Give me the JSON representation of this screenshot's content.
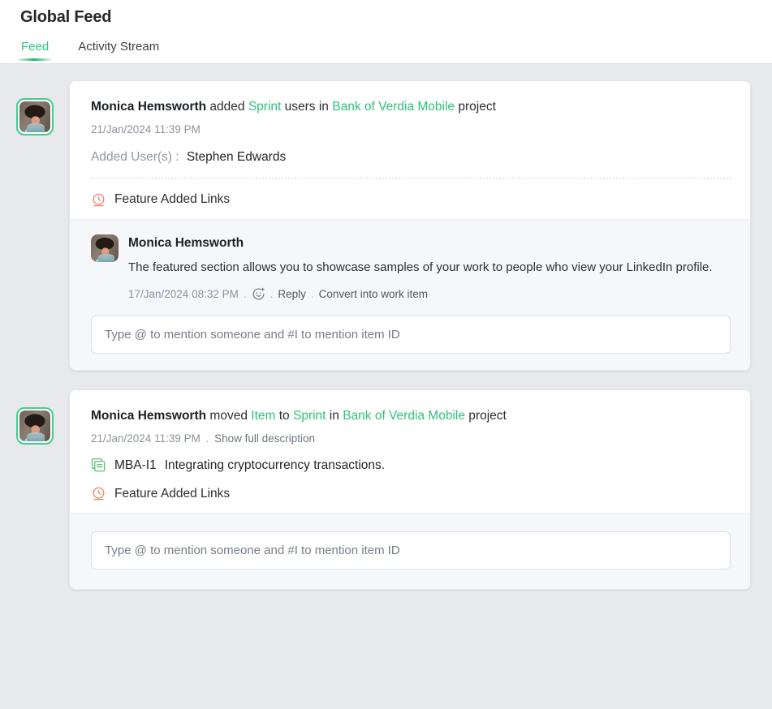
{
  "header": {
    "title": "Global Feed",
    "tabs": [
      {
        "label": "Feed",
        "active": true
      },
      {
        "label": "Activity Stream",
        "active": false
      }
    ]
  },
  "feed": {
    "items": [
      {
        "avatar_alt": "Monica Hemsworth",
        "activity": {
          "actor": "Monica Hemsworth",
          "verb": "added",
          "object": "Sprint",
          "middle": "users in",
          "project": "Bank of Verdia Mobile",
          "suffix": "project"
        },
        "timestamp": "21/Jan/2024 11:39 PM",
        "added_users": {
          "label": "Added User(s) :",
          "value": "Stephen Edwards"
        },
        "feature": {
          "icon": "clock-icon",
          "label": "Feature Added Links"
        },
        "comment": {
          "author": "Monica Hemsworth",
          "text": "The featured section allows you to showcase samples of your work to people who view your LinkedIn profile.",
          "timestamp": "17/Jan/2024 08:32 PM",
          "reaction_icon": "add-reaction-icon",
          "reply_label": "Reply",
          "convert_label": "Convert into work item",
          "separator": "."
        },
        "input_placeholder": "Type @ to mention someone and #I to mention item ID"
      },
      {
        "avatar_alt": "Monica Hemsworth",
        "activity": {
          "actor": "Monica Hemsworth",
          "verb": "moved",
          "object": "Item",
          "middle": "to",
          "object2": "Sprint",
          "middle2": "in",
          "project": "Bank of Verdia Mobile",
          "suffix": "project"
        },
        "timestamp": "21/Jan/2024 11:39 PM",
        "show_description_label": "Show full description",
        "separator": ".",
        "work_item": {
          "icon": "layers-icon",
          "id": "MBA-I1",
          "title": "Integrating cryptocurrency transactions."
        },
        "feature": {
          "icon": "clock-icon",
          "label": "Feature Added Links"
        },
        "input_placeholder": "Type @ to mention someone and #I to mention item ID"
      }
    ]
  },
  "colors": {
    "accent_green": "#2ec27e",
    "feature_icon": "#f0846a",
    "item_icon": "#56c271",
    "page_background": "#e7e9ec",
    "card_background": "#ffffff",
    "comment_background": "#f6f7fb"
  }
}
